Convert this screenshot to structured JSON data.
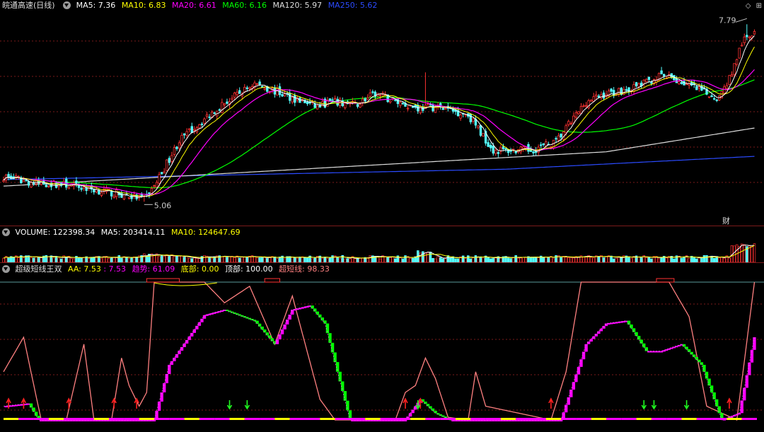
{
  "main_panel": {
    "stock_name": "皖通高速",
    "period": "(日线)",
    "ma_labels": [
      {
        "label": "MA5: 7.36",
        "color": "#ffffff"
      },
      {
        "label": "MA10: 6.83",
        "color": "#ffff00"
      },
      {
        "label": "MA20: 6.61",
        "color": "#ff00ff"
      },
      {
        "label": "MA60: 6.16",
        "color": "#00ff00"
      },
      {
        "label": "MA120: 5.97",
        "color": "#dddddd"
      },
      {
        "label": "MA250: 5.62",
        "color": "#2b4bff"
      }
    ],
    "high_label": "7.79",
    "low_label": "5.06",
    "event_marker": "财"
  },
  "volume_panel": {
    "volume": "VOLUME: 122398.34",
    "ma5": "MA5: 203414.11",
    "ma10": "MA10: 124647.69"
  },
  "indicator_panel": {
    "name": "超级短线王双",
    "aa_label": "AA: 7.53",
    "aa_value": ": 7.53",
    "trend": "趋势: 61.09",
    "bottom": "底部: 0.00",
    "top": "顶部: 100.00",
    "super": "超短线: 98.33"
  },
  "colors": {
    "up": "#ff3232",
    "down": "#54ffff",
    "ma5": "#ffffff",
    "ma10": "#ffff00",
    "ma20": "#ff00ff",
    "ma60": "#00ff00",
    "ma120": "#dddddd",
    "ma250": "#2b4bff",
    "grid": "#7a1a1a",
    "indicator_line": "#ff8080",
    "trend_up": "#ff00ff",
    "trend_down": "#00ff00"
  },
  "chart_data": [
    {
      "type": "candlestick",
      "title": "皖通高速 (日线)",
      "ylim": [
        4.9,
        8.0
      ],
      "candles_sample": [
        {
          "i": 0,
          "o": 5.45,
          "h": 5.5,
          "l": 5.38,
          "c": 5.42
        },
        {
          "i": 50,
          "o": 5.22,
          "h": 5.27,
          "l": 5.13,
          "c": 5.16
        },
        {
          "i": 56,
          "o": 5.14,
          "h": 5.16,
          "l": 5.06,
          "c": 5.1
        },
        {
          "i": 100,
          "o": 6.88,
          "h": 6.93,
          "l": 6.75,
          "c": 6.88
        },
        {
          "i": 150,
          "o": 6.75,
          "h": 7.05,
          "l": 6.58,
          "c": 6.78
        },
        {
          "i": 200,
          "o": 5.75,
          "h": 5.88,
          "l": 5.72,
          "c": 5.83
        },
        {
          "i": 265,
          "o": 6.9,
          "h": 7.06,
          "l": 6.8,
          "c": 6.98
        },
        {
          "i": 295,
          "o": 7.5,
          "h": 7.79,
          "l": 7.32,
          "c": 7.68
        }
      ],
      "ma_last": {
        "MA5": 7.36,
        "MA10": 6.83,
        "MA20": 6.61,
        "MA60": 6.16,
        "MA120": 5.97,
        "MA250": 5.62
      }
    },
    {
      "type": "bar",
      "title": "VOLUME",
      "values_last": {
        "VOLUME": 122398.34,
        "MA5": 203414.11,
        "MA10": 124647.69
      }
    },
    {
      "type": "line",
      "title": "超级短线王双",
      "ylim": [
        0,
        100
      ],
      "values_last": {
        "AA": 7.53,
        "趋势": 61.09,
        "底部": 0.0,
        "顶部": 100.0,
        "超短线": 98.33
      }
    }
  ]
}
